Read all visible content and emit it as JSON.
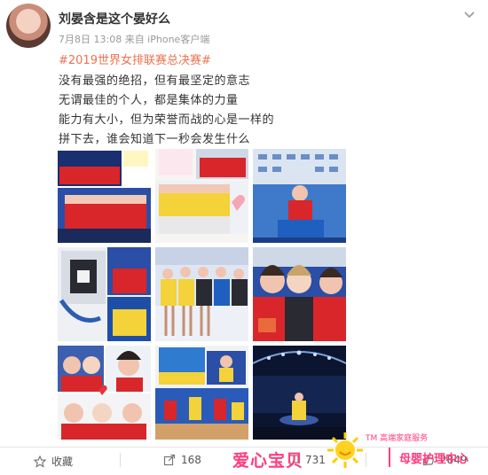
{
  "post": {
    "username": "刘晏含是这个晏好么",
    "meta": "7月8日 13:08 来自 iPhone客户端",
    "hashtag": "#2019世界女排联赛总决赛#",
    "lines": [
      "没有最强的绝招，但有最坚定的意志",
      "无谓最佳的个人，都是集体的力量",
      "能力有大小，但为荣誉而战的心是一样的",
      "拼下去，谁会知道下一秒会发生什么"
    ]
  },
  "actions": {
    "favorite_label": "收藏",
    "share_count": "168",
    "comment_count": "731",
    "like_count": "2849"
  },
  "watermark": {
    "brand": "爱心宝贝",
    "tm": "TM 高端家庭服务",
    "sub": "母婴护理中心"
  },
  "colors": {
    "hashtag": "#eb7350",
    "watermark": "#ff3d7f",
    "jersey_red": "#d9262b",
    "jersey_yellow": "#f3d23a",
    "stage_blue": "#1e4fa8"
  },
  "icons": {
    "favorite": "star-icon",
    "share": "share-icon",
    "comment": "comment-icon",
    "like": "thumbs-up-icon",
    "menu": "chevron-down-icon"
  }
}
